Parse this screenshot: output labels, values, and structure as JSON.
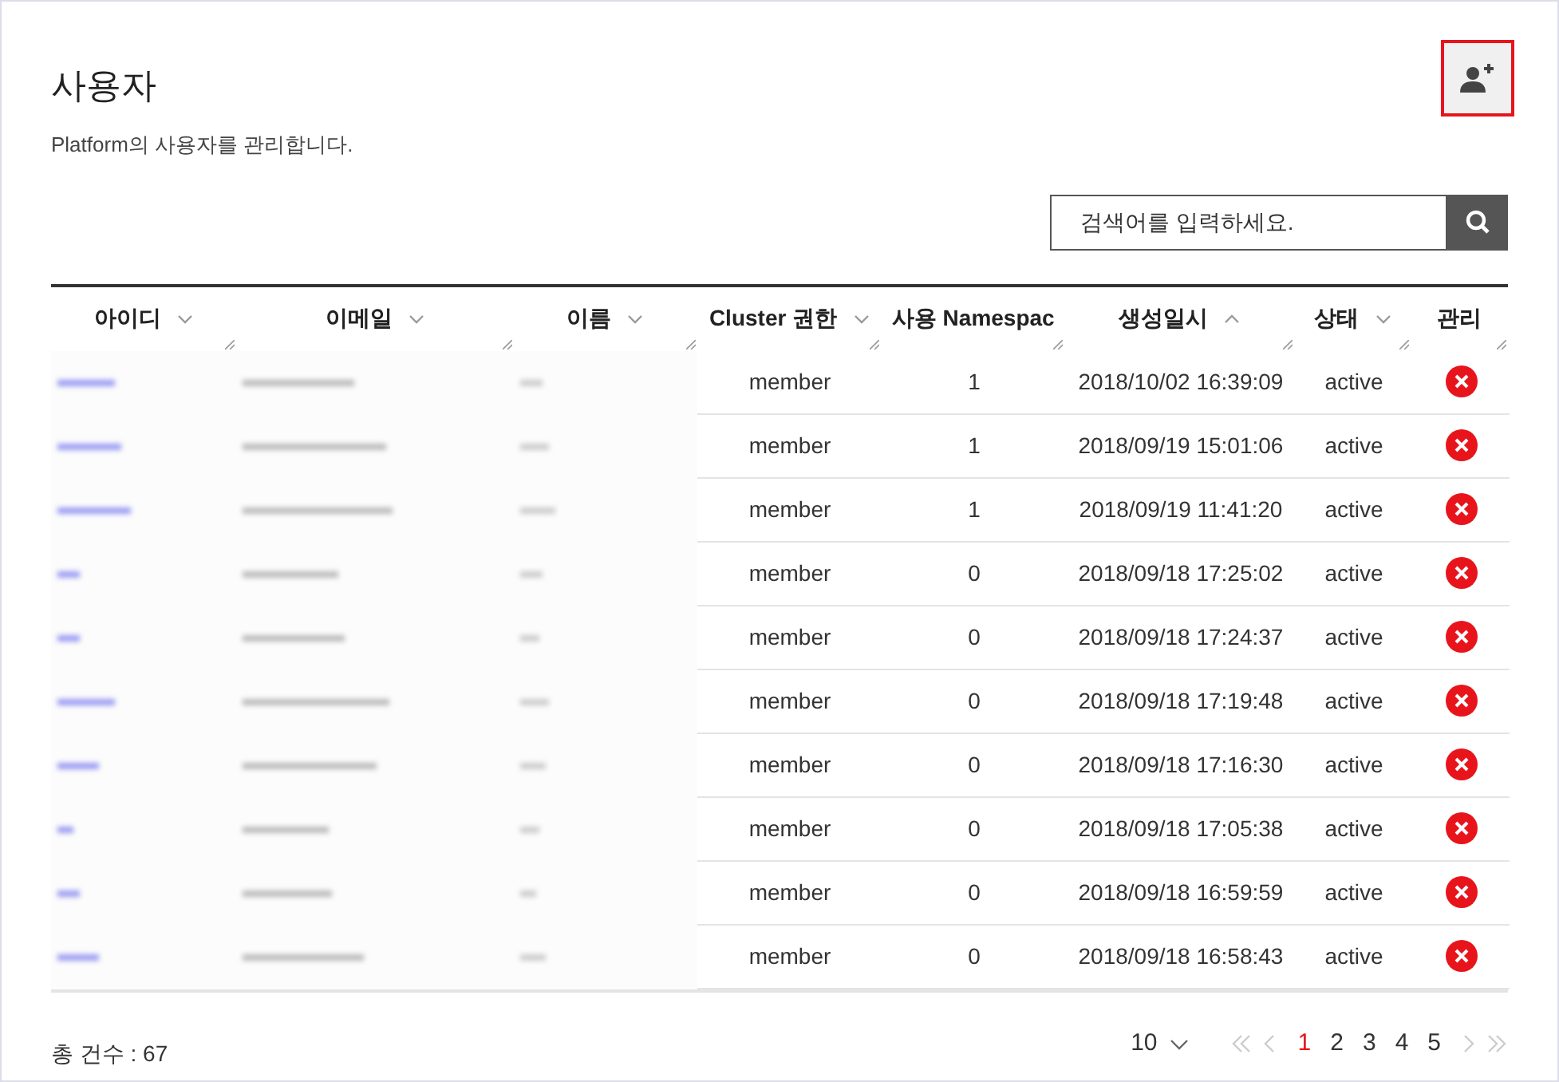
{
  "title": "사용자",
  "description": "Platform의 사용자를 관리합니다.",
  "search": {
    "placeholder": "검색어를 입력하세요."
  },
  "table": {
    "columns": [
      {
        "label": "아이디",
        "ascending": false
      },
      {
        "label": "이메일",
        "ascending": false
      },
      {
        "label": "이름",
        "ascending": false
      },
      {
        "label": "Cluster 권한",
        "ascending": false
      },
      {
        "label": "사용 Namespac"
      },
      {
        "label": "생성일시",
        "ascending": true
      },
      {
        "label": "상태",
        "ascending": false
      },
      {
        "label": "관리"
      }
    ],
    "rows": [
      {
        "role": "member",
        "namespaces": "1",
        "created": "2018/10/02 16:39:09",
        "status": "active"
      },
      {
        "role": "member",
        "namespaces": "1",
        "created": "2018/09/19 15:01:06",
        "status": "active"
      },
      {
        "role": "member",
        "namespaces": "1",
        "created": "2018/09/19 11:41:20",
        "status": "active"
      },
      {
        "role": "member",
        "namespaces": "0",
        "created": "2018/09/18 17:25:02",
        "status": "active"
      },
      {
        "role": "member",
        "namespaces": "0",
        "created": "2018/09/18 17:24:37",
        "status": "active"
      },
      {
        "role": "member",
        "namespaces": "0",
        "created": "2018/09/18 17:19:48",
        "status": "active"
      },
      {
        "role": "member",
        "namespaces": "0",
        "created": "2018/09/18 17:16:30",
        "status": "active"
      },
      {
        "role": "member",
        "namespaces": "0",
        "created": "2018/09/18 17:05:38",
        "status": "active"
      },
      {
        "role": "member",
        "namespaces": "0",
        "created": "2018/09/18 16:59:59",
        "status": "active"
      },
      {
        "role": "member",
        "namespaces": "0",
        "created": "2018/09/18 16:58:43",
        "status": "active"
      }
    ]
  },
  "total": "총 건수 : 67",
  "page_size": "10",
  "pagination": {
    "first_disabled": true,
    "prev_disabled": true,
    "next_disabled": true,
    "last_disabled": true,
    "pages": [
      {
        "label": "1",
        "selected": true
      },
      {
        "label": "2",
        "selected": false
      },
      {
        "label": "3",
        "selected": false
      },
      {
        "label": "4",
        "selected": false
      },
      {
        "label": "5",
        "selected": false
      }
    ]
  }
}
